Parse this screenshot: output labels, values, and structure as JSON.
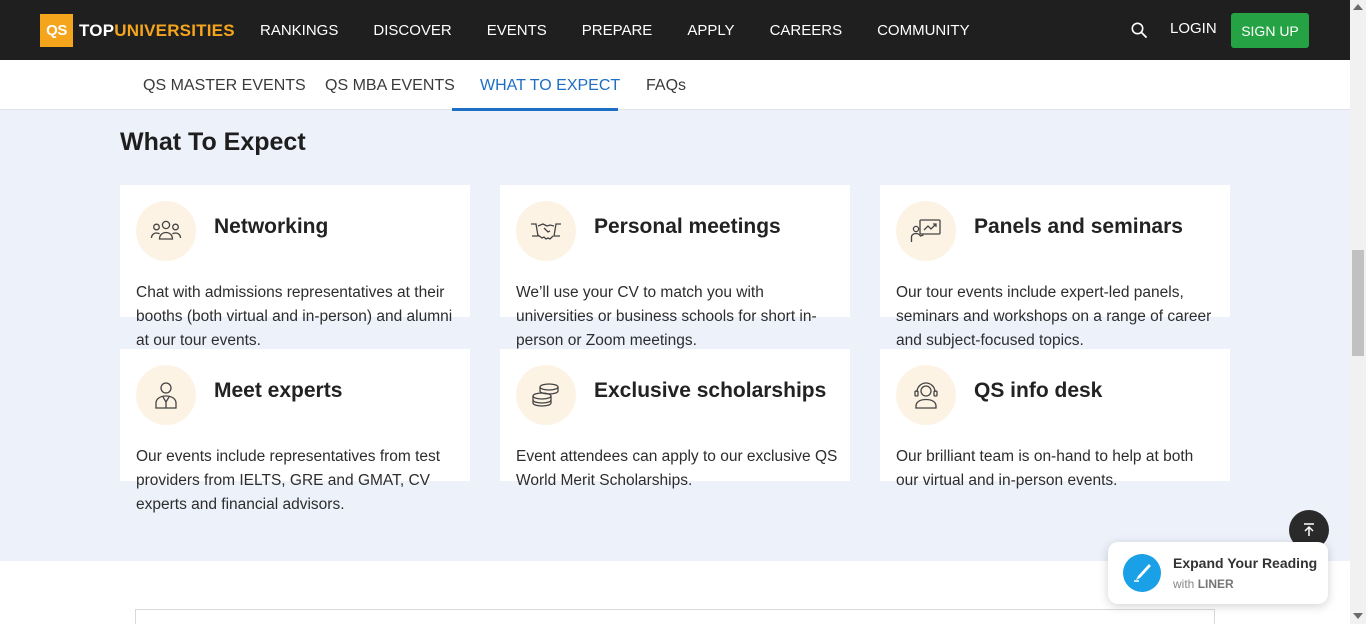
{
  "header": {
    "logo_badge": "QS",
    "logo_text_top": "TOP",
    "logo_text_universities": "UNIVERSITIES",
    "nav": [
      "RANKINGS",
      "DISCOVER",
      "EVENTS",
      "PREPARE",
      "APPLY",
      "CAREERS",
      "COMMUNITY"
    ],
    "login_label": "LOGIN",
    "signup_label": "SIGN UP",
    "search_icon": "search-icon"
  },
  "subnav": {
    "tabs": [
      "QS MASTER EVENTS",
      "QS MBA EVENTS",
      "WHAT TO EXPECT",
      "FAQs"
    ],
    "active": "WHAT TO EXPECT"
  },
  "section": {
    "title": "What To Expect",
    "cards": [
      {
        "icon": "people-group-icon",
        "title": "Networking",
        "desc": "Chat with admissions representatives at their booths (both virtual and in-person) and alumni at our tour events."
      },
      {
        "icon": "handshake-icon",
        "title": "Personal meetings",
        "desc": "We’ll use your CV to match you with universities or business schools for short in-person or Zoom meetings."
      },
      {
        "icon": "presentation-icon",
        "title": "Panels and seminars",
        "desc": "Our tour events include expert-led panels, seminars and workshops on a range of career and subject-focused topics."
      },
      {
        "icon": "expert-person-icon",
        "title": "Meet experts",
        "desc": "Our events include representatives from test providers from IELTS, GRE and GMAT, CV experts and financial advisors."
      },
      {
        "icon": "coins-stack-icon",
        "title": "Exclusive scholarships",
        "desc": "Event attendees can apply to our exclusive QS World Merit Scholarships."
      },
      {
        "icon": "headset-support-icon",
        "title": "QS info desk",
        "desc": "Our brilliant team is on-hand to help at both our virtual and in-person events."
      }
    ]
  },
  "liner": {
    "title": "Expand Your Reading",
    "sub_prefix": "with",
    "sub_brand": "LINER"
  },
  "colors": {
    "topbar": "#1f1f1f",
    "brand_orange": "#f4a51c",
    "signup_green": "#25a244",
    "active_tab": "#1d6ec4",
    "page_bg": "#edf1fa"
  }
}
